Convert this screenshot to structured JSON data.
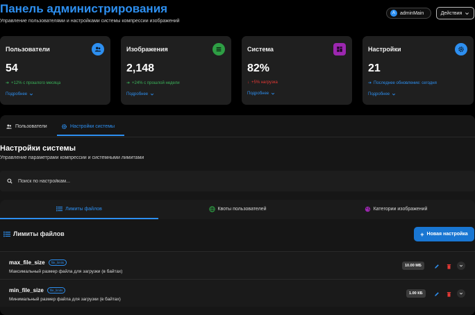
{
  "header": {
    "title": "Панель администрирования",
    "subtitle": "Управление пользователями и настройками системы компрессии изображений",
    "user": {
      "initial": "A",
      "name": "adminMain"
    },
    "actions_label": "Действия"
  },
  "cards": [
    {
      "title": "Пользователи",
      "value": "54",
      "change": "+12% с прошлого месяца",
      "more": "Подробнее",
      "icon": "users-icon",
      "color": "#2d8ff0",
      "trend": "up"
    },
    {
      "title": "Изображения",
      "value": "2,148",
      "change": "+24% с прошлой недели",
      "more": "Подробнее",
      "icon": "images-icon",
      "color": "#2e9e44",
      "trend": "up"
    },
    {
      "title": "Система",
      "value": "82%",
      "change": "+5% нагрузка",
      "more": "Подробнее",
      "icon": "system-icon",
      "color": "#9c27b0",
      "trend": "down"
    },
    {
      "title": "Настройки",
      "value": "21",
      "change": "Последнее обновление: сегодня",
      "more": "Подробнее",
      "icon": "settings-icon",
      "color": "#2d8ff0",
      "trend": "info"
    }
  ],
  "tabs": [
    {
      "label": "Пользователи",
      "active": false
    },
    {
      "label": "Настройки системы",
      "active": true
    }
  ],
  "settings": {
    "title": "Настройки системы",
    "subtitle": "Управление параметрами компрессии и системными лимитами",
    "search_placeholder": "Поиск по настройкам..."
  },
  "subtabs": [
    {
      "label": "Лимиты файлов",
      "active": true,
      "color": "#2d8ff0"
    },
    {
      "label": "Квоты пользователей",
      "active": false,
      "color": "#2e9e44"
    },
    {
      "label": "Категории изображений",
      "active": false,
      "color": "#9c27b0"
    }
  ],
  "limits": {
    "title": "Лимиты файлов",
    "new_button": "Новая настройка",
    "rows": [
      {
        "name": "max_file_size",
        "tag": "file_limits",
        "description": "Максимальный размер файла для загрузки (в байтах)",
        "value": "10.00 МБ"
      },
      {
        "name": "min_file_size",
        "tag": "file_limits",
        "description": "Минимальный размер файла для загрузки (в байтах)",
        "value": "1.00 КБ"
      }
    ]
  },
  "colors": {
    "accent": "#2d8ff0",
    "success": "#2e9e44",
    "danger": "#e53935"
  }
}
